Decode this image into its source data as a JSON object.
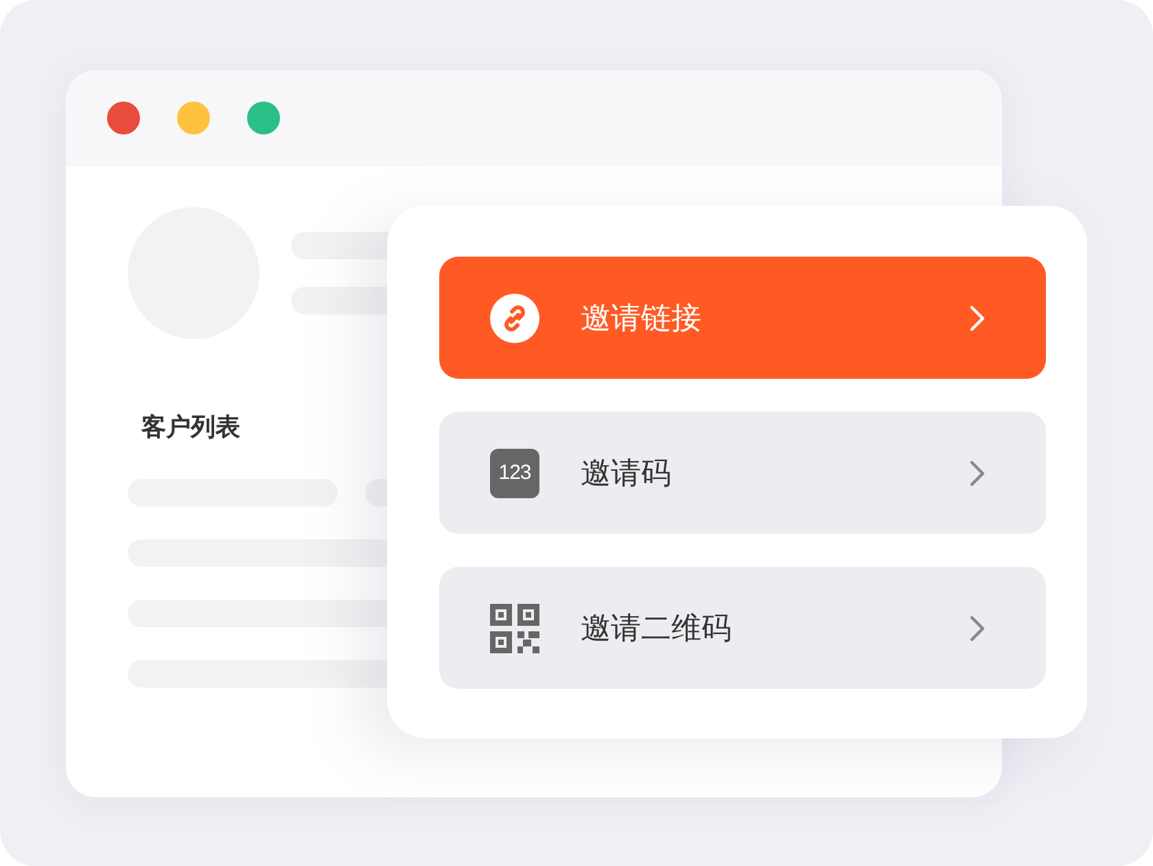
{
  "window": {
    "controls": [
      {
        "color": "#e84c3d"
      },
      {
        "color": "#ffc23f"
      },
      {
        "color": "#2bbf88"
      }
    ],
    "section_title": "客户列表"
  },
  "invite_menu": {
    "items": [
      {
        "kind": "link",
        "label": "邀请链接",
        "selected": true
      },
      {
        "kind": "code",
        "label": "邀请码",
        "badge": "123",
        "selected": false
      },
      {
        "kind": "qr",
        "label": "邀请二维码",
        "selected": false
      }
    ]
  }
}
